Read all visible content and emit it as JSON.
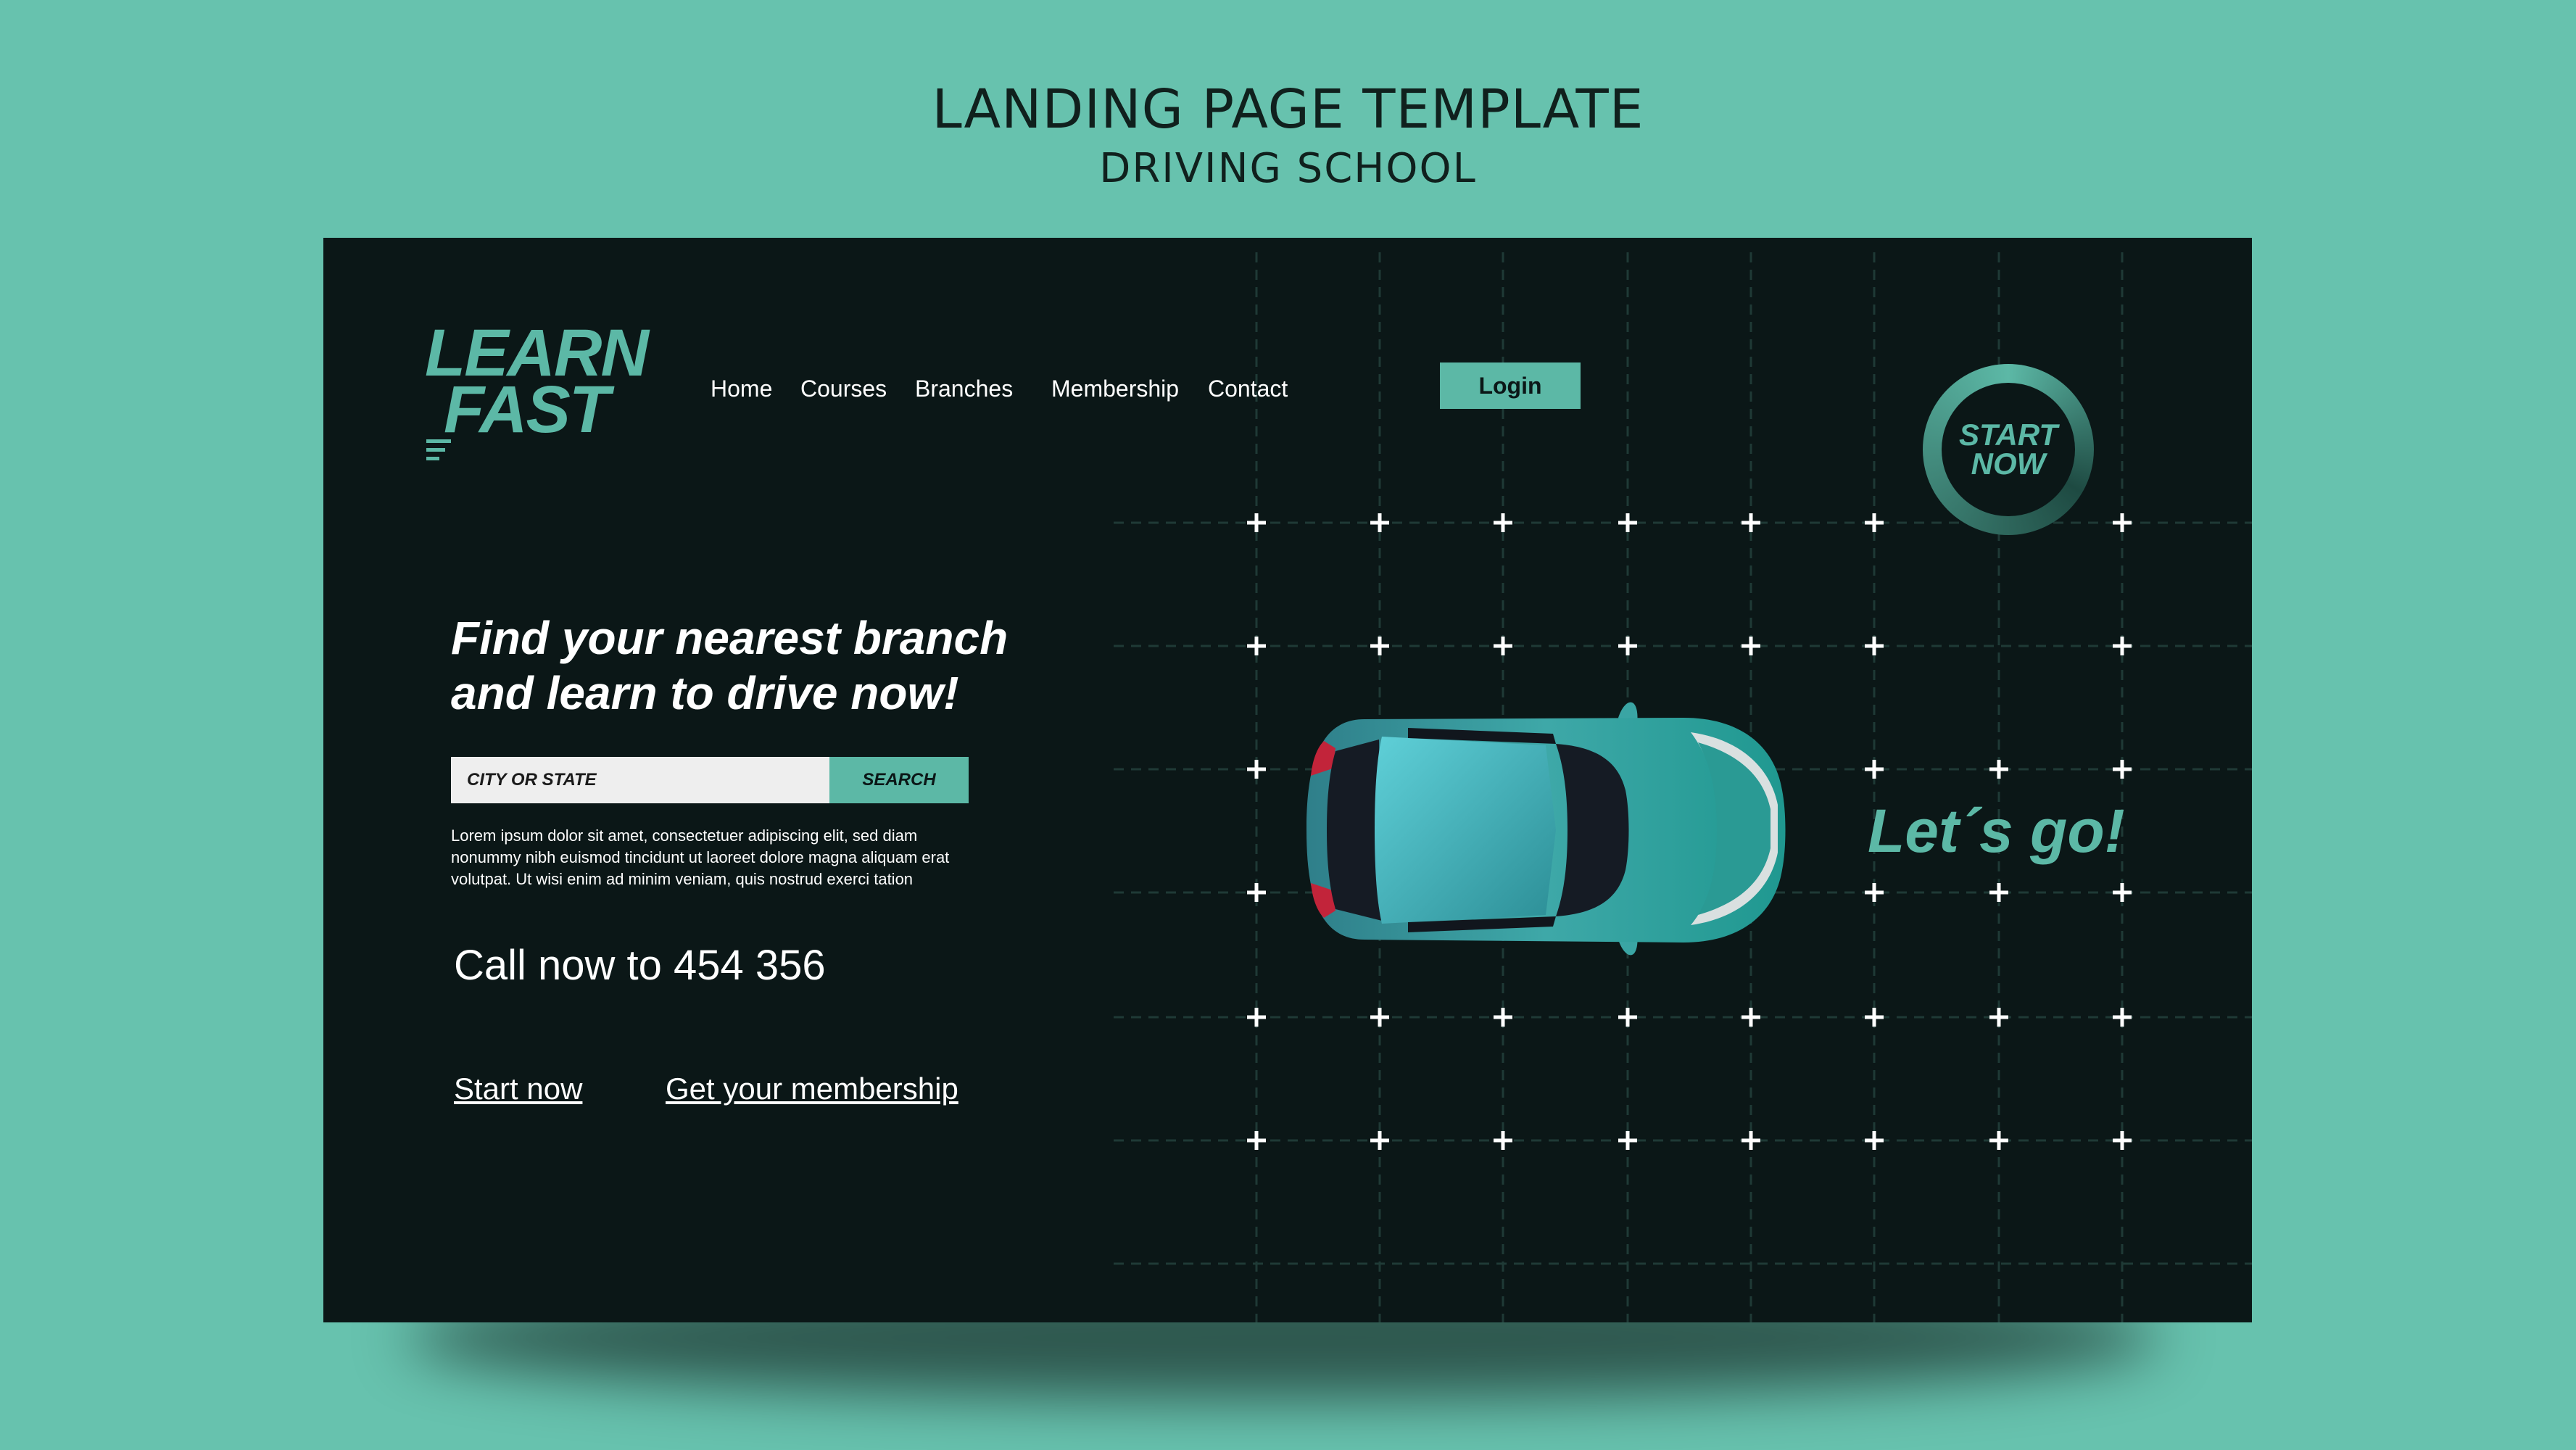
{
  "poster": {
    "title": "LANDING PAGE TEMPLATE",
    "subtitle": "DRIVING SCHOOL"
  },
  "colors": {
    "background": "#67c2ae",
    "page_bg": "#0b1717",
    "accent": "#5cb8a6",
    "text": "#ffffff"
  },
  "header": {
    "logo_line1": "LEARN",
    "logo_line2": "FAST",
    "nav": [
      "Home",
      "Courses",
      "Branches",
      "Membership",
      "Contact"
    ],
    "login_label": "Login"
  },
  "badge": {
    "line1": "START",
    "line2": "NOW"
  },
  "hero": {
    "headline_line1": "Find your nearest branch",
    "headline_line2": "and learn to drive now!",
    "search_placeholder": "CITY OR STATE",
    "search_button": "SEARCH",
    "body_line1": "Lorem ipsum dolor sit amet, consectetuer adipiscing elit, sed diam",
    "body_line2": "nonummy nibh euismod tincidunt ut  laoreet dolore magna aliquam erat",
    "body_line3": "volutpat. Ut wisi enim ad minim veniam, quis nostrud exerci tation",
    "phone": "Call now to 454 356",
    "cta_start": "Start now",
    "cta_membership": "Get your membership"
  },
  "illustration": {
    "tagline": "Let´s go!",
    "car_icon": "car-top-view-icon",
    "grid_marker_icon": "plus-icon"
  }
}
